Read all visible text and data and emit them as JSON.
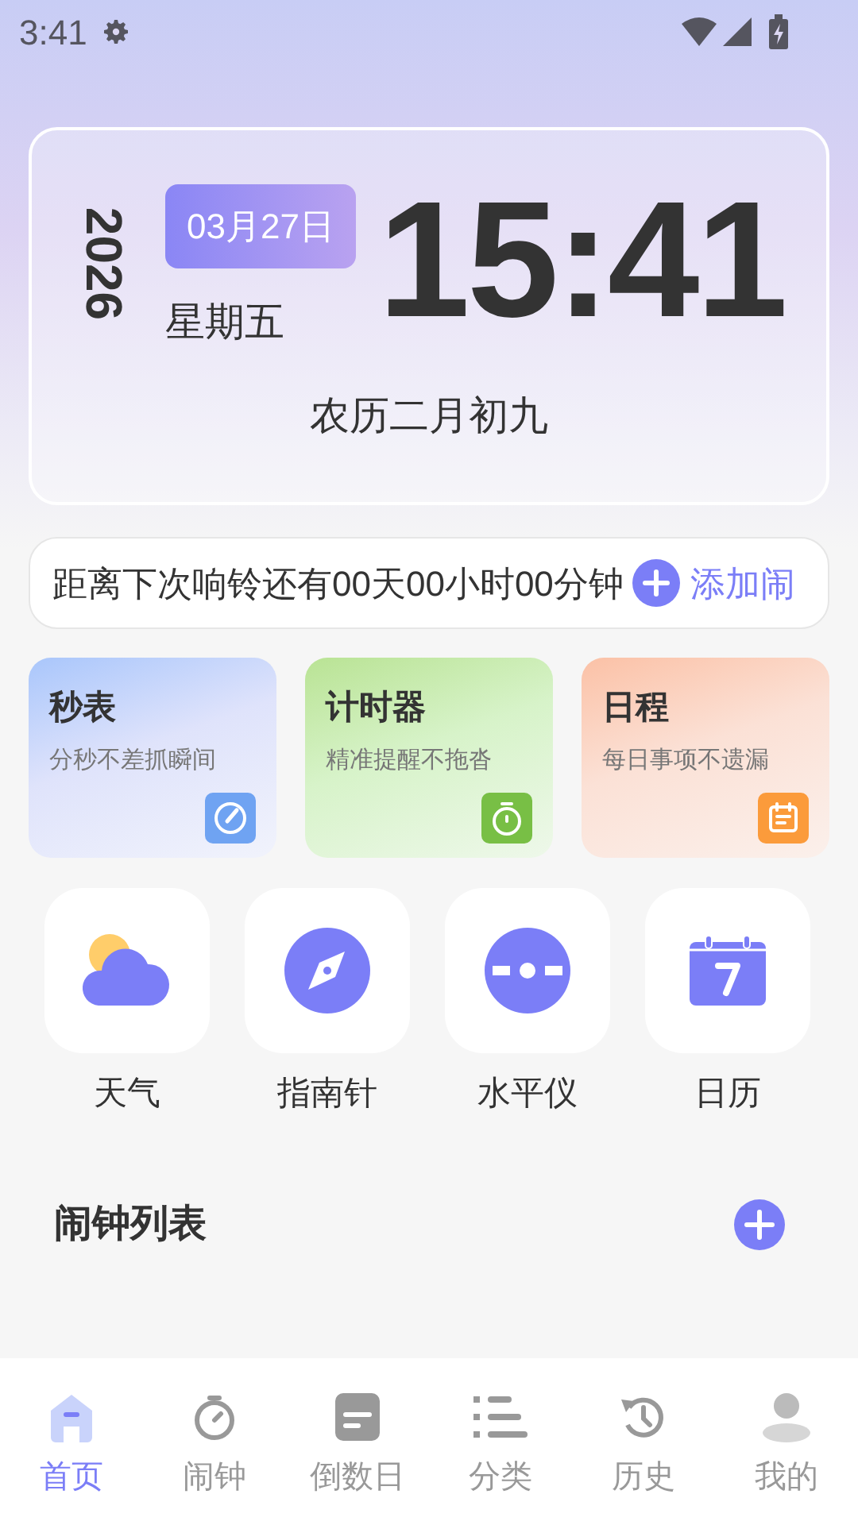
{
  "status_bar": {
    "time": "3:41"
  },
  "clock": {
    "year": "2026",
    "date": "03月27日",
    "weekday": "星期五",
    "time": "15:41",
    "lunar": "农历二月初九"
  },
  "next_alarm": {
    "text": "距离下次响铃还有00天00小时00分钟",
    "action": "添加闹"
  },
  "feature_cards": [
    {
      "kind": "stopwatch",
      "title": "秒表",
      "subtitle": "分秒不差抓瞬间"
    },
    {
      "kind": "timer",
      "title": "计时器",
      "subtitle": "精准提醒不拖沓"
    },
    {
      "kind": "schedule",
      "title": "日程",
      "subtitle": "每日事项不遗漏"
    }
  ],
  "tools": [
    {
      "kind": "weather",
      "label": "天气"
    },
    {
      "kind": "compass",
      "label": "指南针"
    },
    {
      "kind": "level",
      "label": "水平仪"
    },
    {
      "kind": "calendar",
      "label": "日历"
    }
  ],
  "alarm_list": {
    "title": "闹钟列表"
  },
  "nav": [
    {
      "kind": "home",
      "label": "首页",
      "selected": true
    },
    {
      "kind": "alarm",
      "label": "闹钟",
      "selected": false
    },
    {
      "kind": "countdown",
      "label": "倒数日",
      "selected": false
    },
    {
      "kind": "category",
      "label": "分类",
      "selected": false
    },
    {
      "kind": "history",
      "label": "历史",
      "selected": false
    },
    {
      "kind": "profile",
      "label": "我的",
      "selected": false
    }
  ]
}
